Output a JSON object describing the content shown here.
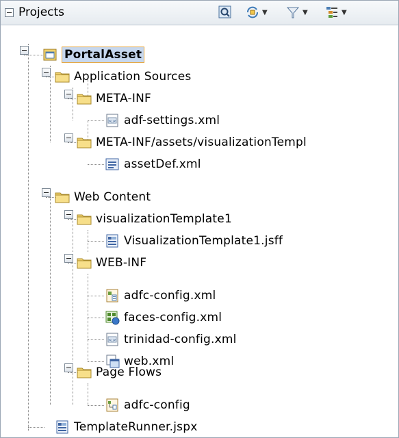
{
  "header": {
    "title": "Projects"
  },
  "tree": {
    "root": "PortalAsset",
    "app_sources": "Application Sources",
    "meta_inf": "META-INF",
    "adf_settings": "adf-settings.xml",
    "meta_inf_assets": "META-INF/assets/visualizationTempl",
    "asset_def": "assetDef.xml",
    "web_content": "Web Content",
    "vis_template_folder": "visualizationTemplate1",
    "vis_template_file": "VisualizationTemplate1.jsff",
    "web_inf": "WEB-INF",
    "adfc_config_xml": "adfc-config.xml",
    "faces_config": "faces-config.xml",
    "trinidad_config": "trinidad-config.xml",
    "web_xml": "web.xml",
    "page_flows": "Page Flows",
    "adfc_config": "adfc-config",
    "template_runner": "TemplateRunner.jspx"
  }
}
